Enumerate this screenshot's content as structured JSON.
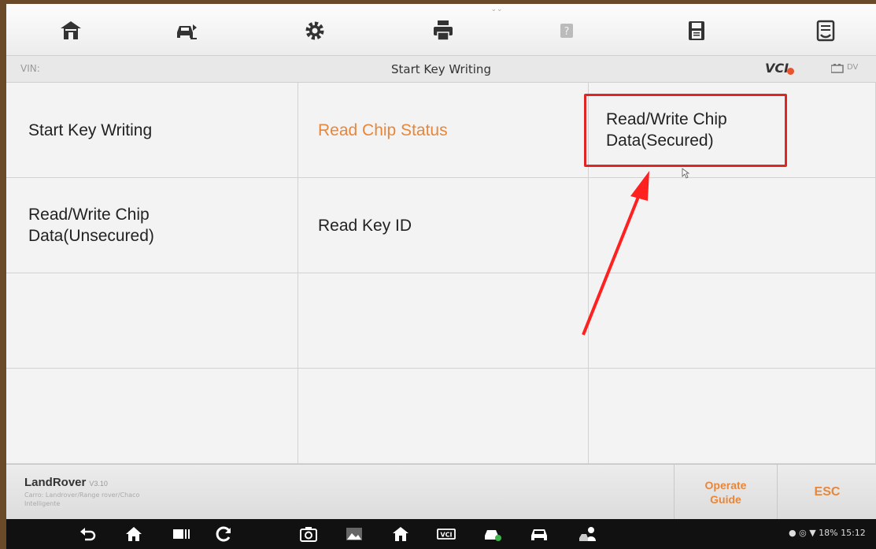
{
  "toolbar": {
    "items": [
      {
        "icon": "home-icon"
      },
      {
        "icon": "vehicle-swap-icon"
      },
      {
        "icon": "settings-gear-icon"
      },
      {
        "icon": "print-icon"
      },
      {
        "icon": "help-icon"
      },
      {
        "icon": "save-icon"
      },
      {
        "icon": "report-icon"
      }
    ]
  },
  "subheader": {
    "vin_label": "VIN:",
    "title": "Start Key Writing",
    "vci_label": "VCI",
    "battery_label": "DV"
  },
  "menu": {
    "items": [
      {
        "label": "Start Key Writing",
        "color": "#222222"
      },
      {
        "label": "Read Chip Status",
        "color": "#e8863a"
      },
      {
        "label": "Read/Write Chip Data(Secured)",
        "color": "#222222"
      },
      {
        "label": "Read/Write Chip Data(Unsecured)",
        "color": "#222222"
      },
      {
        "label": "Read Key ID",
        "color": "#222222"
      }
    ]
  },
  "annotation": {
    "box_color": "#e02525",
    "arrow_color": "#ff2020"
  },
  "infobar": {
    "brand": "LandRover",
    "version": "V3.10",
    "car_path": "Carro: Landrover/Range rover/Chaco",
    "car_sub": "Intelligente",
    "operate_guide": "Operate Guide",
    "esc": "ESC"
  },
  "navbar": {
    "status_text": "18% 15:12"
  }
}
